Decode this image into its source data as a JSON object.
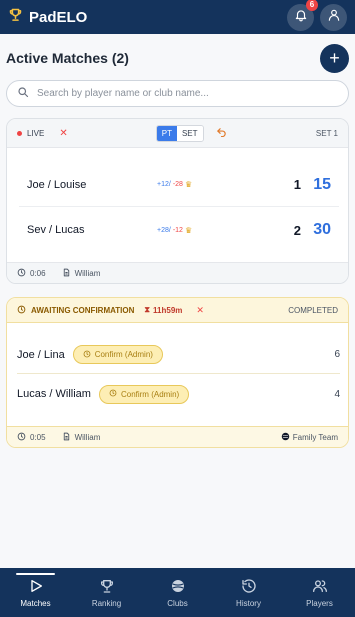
{
  "app": {
    "title": "PadELO",
    "notifications_count": "6"
  },
  "page": {
    "title": "Active Matches (2)"
  },
  "search": {
    "placeholder": "Search by player name or club name..."
  },
  "live_match": {
    "status": "LIVE",
    "toggle": {
      "options": [
        "PT",
        "SET"
      ],
      "selected": "PT"
    },
    "set_label": "SET 1",
    "teams": [
      {
        "name": "Joe / Louise",
        "elo_plus": "+12/",
        "elo_minus": "-28",
        "sets": "1",
        "games": "15"
      },
      {
        "name": "Sev / Lucas",
        "elo_plus": "+28/",
        "elo_minus": "-12",
        "sets": "2",
        "games": "30"
      }
    ],
    "footer": {
      "time": "0:06",
      "author": "William"
    }
  },
  "pending_match": {
    "status": "AWAITING CONFIRMATION",
    "timer": "11h59m",
    "completed_label": "COMPLETED",
    "teams": [
      {
        "name": "Joe / Lina",
        "confirm_label": "Confirm (Admin)",
        "score": "6"
      },
      {
        "name": "Lucas / William",
        "confirm_label": "Confirm (Admin)",
        "score": "4"
      }
    ],
    "footer": {
      "time": "0:05",
      "author": "William",
      "club": "Family Team"
    }
  },
  "nav": [
    {
      "label": "Matches",
      "icon": "play-icon",
      "active": true
    },
    {
      "label": "Ranking",
      "icon": "trophy-icon",
      "active": false
    },
    {
      "label": "Clubs",
      "icon": "ball-icon",
      "active": false
    },
    {
      "label": "History",
      "icon": "history-icon",
      "active": false
    },
    {
      "label": "Players",
      "icon": "users-icon",
      "active": false
    }
  ],
  "colors": {
    "navy": "#14335c",
    "accent_blue": "#2f6fdd",
    "live_red": "#ef4444",
    "pending_yellow": "#fdeeb4"
  }
}
